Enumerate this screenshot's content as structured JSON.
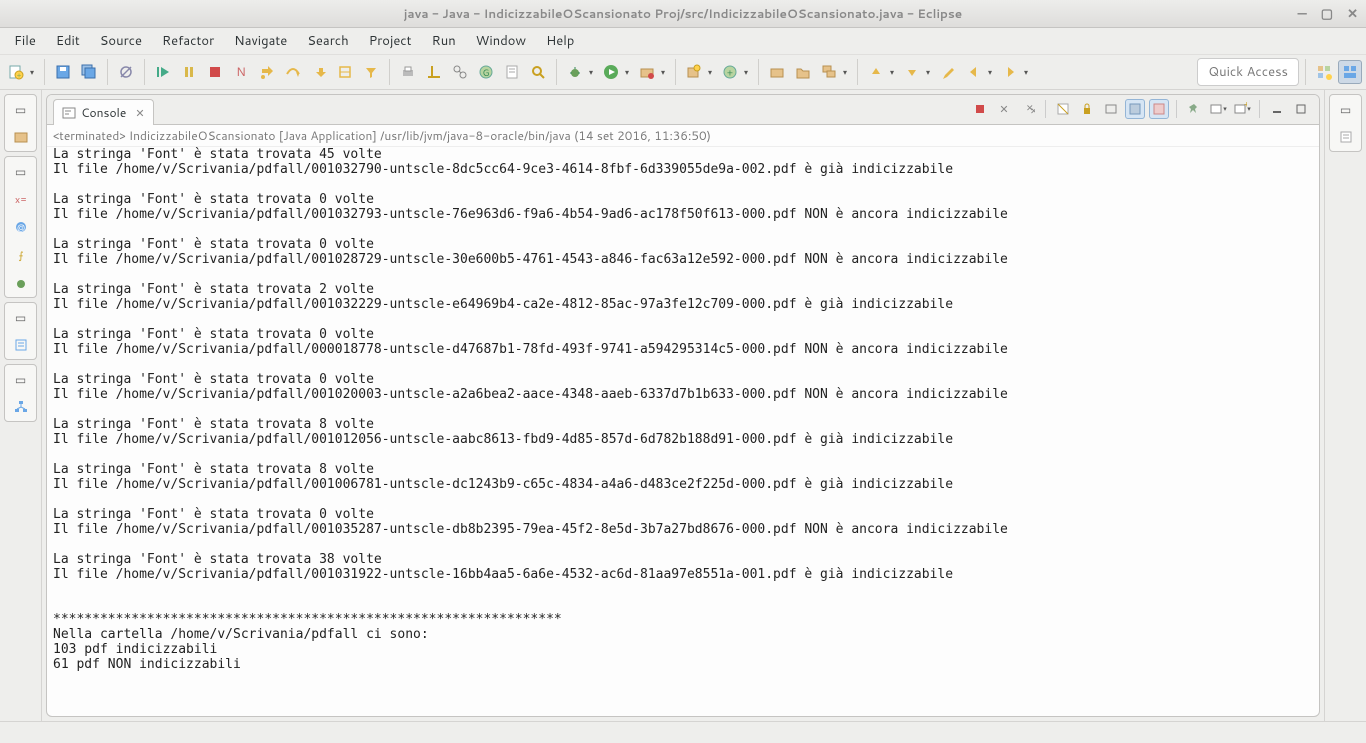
{
  "window": {
    "title": "java - Java - IndicizzabileOScansionato Proj/src/IndicizzabileOScansionato.java - Eclipse"
  },
  "menubar": [
    "File",
    "Edit",
    "Source",
    "Refactor",
    "Navigate",
    "Search",
    "Project",
    "Run",
    "Window",
    "Help"
  ],
  "quick_access": "Quick Access",
  "console": {
    "tab_label": "Console",
    "header": "<terminated> IndicizzabileOScansionato [Java Application] /usr/lib/jvm/java-8-oracle/bin/java (14 set 2016, 11:36:50)",
    "output": "La stringa 'Font' è stata trovata 45 volte\nIl file /home/v/Scrivania/pdfall/001032790-untscle-8dc5cc64-9ce3-4614-8fbf-6d339055de9a-002.pdf è già indicizzabile\n\nLa stringa 'Font' è stata trovata 0 volte\nIl file /home/v/Scrivania/pdfall/001032793-untscle-76e963d6-f9a6-4b54-9ad6-ac178f50f613-000.pdf NON è ancora indicizzabile\n\nLa stringa 'Font' è stata trovata 0 volte\nIl file /home/v/Scrivania/pdfall/001028729-untscle-30e600b5-4761-4543-a846-fac63a12e592-000.pdf NON è ancora indicizzabile\n\nLa stringa 'Font' è stata trovata 2 volte\nIl file /home/v/Scrivania/pdfall/001032229-untscle-e64969b4-ca2e-4812-85ac-97a3fe12c709-000.pdf è già indicizzabile\n\nLa stringa 'Font' è stata trovata 0 volte\nIl file /home/v/Scrivania/pdfall/000018778-untscle-d47687b1-78fd-493f-9741-a594295314c5-000.pdf NON è ancora indicizzabile\n\nLa stringa 'Font' è stata trovata 0 volte\nIl file /home/v/Scrivania/pdfall/001020003-untscle-a2a6bea2-aace-4348-aaeb-6337d7b1b633-000.pdf NON è ancora indicizzabile\n\nLa stringa 'Font' è stata trovata 8 volte\nIl file /home/v/Scrivania/pdfall/001012056-untscle-aabc8613-fbd9-4d85-857d-6d782b188d91-000.pdf è già indicizzabile\n\nLa stringa 'Font' è stata trovata 8 volte\nIl file /home/v/Scrivania/pdfall/001006781-untscle-dc1243b9-c65c-4834-a4a6-d483ce2f225d-000.pdf è già indicizzabile\n\nLa stringa 'Font' è stata trovata 0 volte\nIl file /home/v/Scrivania/pdfall/001035287-untscle-db8b2395-79ea-45f2-8e5d-3b7a27bd8676-000.pdf NON è ancora indicizzabile\n\nLa stringa 'Font' è stata trovata 38 volte\nIl file /home/v/Scrivania/pdfall/001031922-untscle-16bb4aa5-6a6e-4532-ac6d-81aa97e8551a-001.pdf è già indicizzabile\n\n\n*****************************************************************\nNella cartella /home/v/Scrivania/pdfall ci sono:\n103 pdf indicizzabili\n61 pdf NON indicizzabili\n"
  }
}
